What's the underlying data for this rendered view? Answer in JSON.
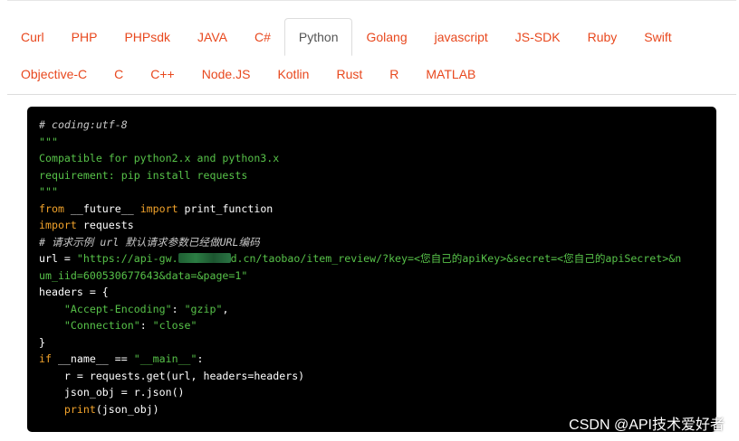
{
  "tabs": {
    "row1": [
      "Curl",
      "PHP",
      "PHPsdk",
      "JAVA",
      "C#",
      "Python",
      "Golang",
      "javascript",
      "JS-SDK",
      "Ruby",
      "Swift"
    ],
    "row2": [
      "Objective-C",
      "C",
      "C++",
      "Node.JS",
      "Kotlin",
      "Rust",
      "R",
      "MATLAB"
    ],
    "active": "Python"
  },
  "code": {
    "line1": "# coding:utf-8",
    "line2": "\"\"\"",
    "line3": "Compatible for python2.x and python3.x",
    "line4": "requirement: pip install requests",
    "line5": "\"\"\"",
    "line6_kw1": "from",
    "line6_a": " __future__ ",
    "line6_kw2": "import",
    "line6_b": " print_function",
    "line7_kw": "import",
    "line7_b": " requests",
    "line8": "# 请求示例 url 默认请求参数已经做URL编码",
    "line9_a": "url = ",
    "line9_str_pre": "\"https://api-gw.",
    "line9_str_post": "d.cn/taobao/item_review/?key=<您自己的apiKey>&secret=<您自己的apiSecret>&n",
    "line10_str": "um_iid=600530677643&data=&page=1\"",
    "line11": "headers = {",
    "line12_indent": "    ",
    "line12_k": "\"Accept-Encoding\"",
    "line12_sep": ": ",
    "line12_v": "\"gzip\"",
    "line12_end": ",",
    "line13_indent": "    ",
    "line13_k": "\"Connection\"",
    "line13_sep": ": ",
    "line13_v": "\"close\"",
    "line14": "}",
    "line15_kw": "if",
    "line15_a": " __name__ == ",
    "line15_str": "\"__main__\"",
    "line15_b": ":",
    "line16": "    r = requests.get(url, headers=headers)",
    "line17": "    json_obj = r.json()",
    "line18_indent": "    ",
    "line18_kw": "print",
    "line18_b": "(json_obj)"
  },
  "watermark": "CSDN @API技术爱好者"
}
